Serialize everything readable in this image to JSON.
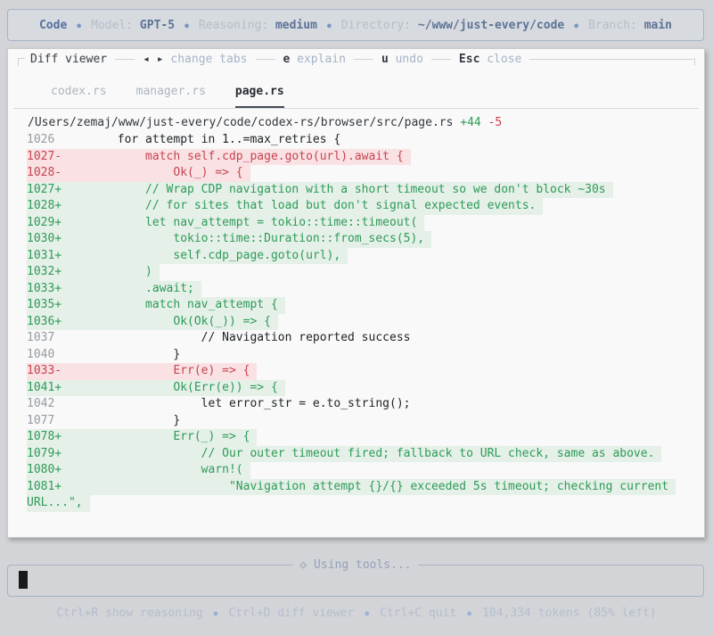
{
  "top_bar": {
    "app": "Code",
    "separator": "●",
    "items": [
      {
        "label": "Model:",
        "value": "GPT-5"
      },
      {
        "label": "Reasoning:",
        "value": "medium"
      },
      {
        "label": "Directory:",
        "value": "~/www/just-every/code"
      },
      {
        "label": "Branch:",
        "value": "main"
      }
    ]
  },
  "diff_viewer": {
    "title": "Diff viewer",
    "hints": [
      {
        "key": "◂ ▸",
        "label": "change tabs",
        "arrows": true
      },
      {
        "key": "e",
        "label": "explain"
      },
      {
        "key": "u",
        "label": "undo"
      },
      {
        "key": "Esc",
        "label": "close"
      }
    ],
    "tabs": [
      {
        "label": "codex.rs",
        "active": false
      },
      {
        "label": "manager.rs",
        "active": false
      },
      {
        "label": "page.rs",
        "active": true
      }
    ],
    "file": {
      "path": "/Users/zemaj/www/just-every/code/codex-rs/browser/src/page.rs",
      "additions": "+44",
      "deletions": "-5"
    },
    "rows": [
      {
        "num": "1026",
        "sign": " ",
        "type": "ctx",
        "code": "        for attempt in 1..=max_retries {"
      },
      {
        "num": "1027",
        "sign": "-",
        "type": "del",
        "code": "            match self.cdp_page.goto(url).await {"
      },
      {
        "num": "1028",
        "sign": "-",
        "type": "del",
        "code": "                Ok(_) => {"
      },
      {
        "num": "1027",
        "sign": "+",
        "type": "add",
        "code": "            // Wrap CDP navigation with a short timeout so we don't block ~30s"
      },
      {
        "num": "1028",
        "sign": "+",
        "type": "add",
        "code": "            // for sites that load but don't signal expected events."
      },
      {
        "num": "1029",
        "sign": "+",
        "type": "add",
        "code": "            let nav_attempt = tokio::time::timeout("
      },
      {
        "num": "1030",
        "sign": "+",
        "type": "add",
        "code": "                tokio::time::Duration::from_secs(5),"
      },
      {
        "num": "1031",
        "sign": "+",
        "type": "add",
        "code": "                self.cdp_page.goto(url),"
      },
      {
        "num": "1032",
        "sign": "+",
        "type": "add",
        "code": "            )"
      },
      {
        "num": "1033",
        "sign": "+",
        "type": "add",
        "code": "            .await;"
      },
      {
        "num": "1035",
        "sign": "+",
        "type": "add",
        "code": "            match nav_attempt {"
      },
      {
        "num": "1036",
        "sign": "+",
        "type": "add",
        "code": "                Ok(Ok(_)) => {"
      },
      {
        "num": "1037",
        "sign": " ",
        "type": "ctx",
        "code": "                    // Navigation reported success"
      },
      {
        "num": "1040",
        "sign": " ",
        "type": "ctx",
        "code": "                }"
      },
      {
        "num": "1033",
        "sign": "-",
        "type": "del",
        "code": "                Err(e) => {"
      },
      {
        "num": "1041",
        "sign": "+",
        "type": "add",
        "code": "                Ok(Err(e)) => {"
      },
      {
        "num": "1042",
        "sign": " ",
        "type": "ctx",
        "code": "                    let error_str = e.to_string();"
      },
      {
        "num": "1077",
        "sign": " ",
        "type": "ctx",
        "code": "                }"
      },
      {
        "num": "1078",
        "sign": "+",
        "type": "add",
        "code": "                Err(_) => {"
      },
      {
        "num": "1079",
        "sign": "+",
        "type": "add",
        "code": "                    // Our outer timeout fired; fallback to URL check, same as above."
      },
      {
        "num": "1080",
        "sign": "+",
        "type": "add",
        "code": "                    warn!("
      },
      {
        "num": "1081",
        "sign": "+",
        "type": "add",
        "code": "                        \"Navigation attempt {}/{} exceeded 5s timeout; checking current"
      },
      {
        "num": "",
        "sign": "",
        "type": "addc",
        "code": "URL...\","
      }
    ]
  },
  "composer": {
    "status": "◇ Using tools..."
  },
  "footer": {
    "separator": "●",
    "hints": [
      {
        "key": "Ctrl+R",
        "label": "show reasoning"
      },
      {
        "key": "Ctrl+D",
        "label": "diff viewer"
      },
      {
        "key": "Ctrl+C",
        "label": "quit"
      }
    ],
    "tokens": "104,334 tokens (85% left)"
  }
}
